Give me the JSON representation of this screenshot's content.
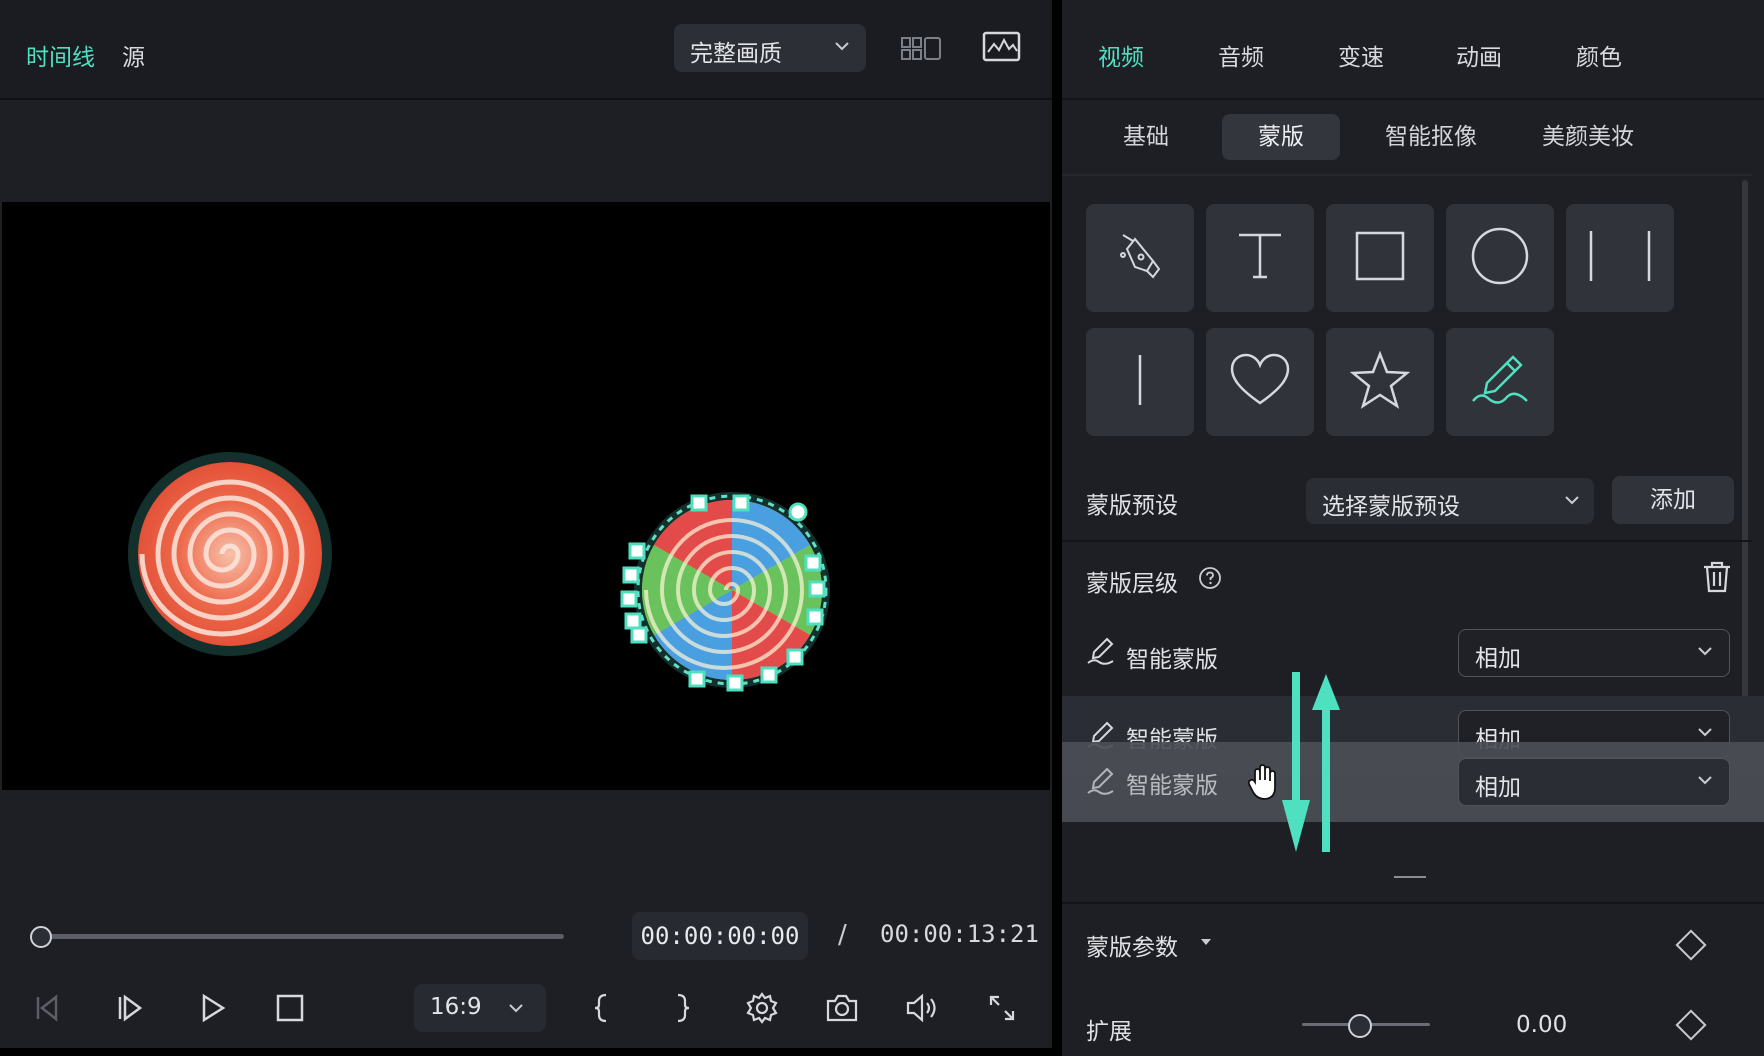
{
  "colors": {
    "accent": "#4fe0c0",
    "panel": "#1d1f24",
    "control": "#30333a"
  },
  "player": {
    "tabs": [
      {
        "label": "时间线",
        "active": true
      },
      {
        "label": "源",
        "active": false
      }
    ],
    "quality": "完整画质",
    "icons": {
      "grid": "grid-view-icon",
      "scope": "waveform-scope-icon"
    },
    "timecode_current": "00:00:00:00",
    "timecode_separator": "/",
    "timecode_total": "00:00:13:21",
    "progress": 0,
    "aspect_ratio": "16:9",
    "controls": [
      "prev-frame-icon",
      "step-forward-icon",
      "play-icon",
      "stop-icon",
      "mark-in-icon",
      "mark-out-icon",
      "settings-icon",
      "snapshot-icon",
      "volume-icon",
      "fullscreen-icon"
    ]
  },
  "panel": {
    "main_tabs": [
      {
        "label": "视频",
        "active": true
      },
      {
        "label": "音频"
      },
      {
        "label": "变速"
      },
      {
        "label": "动画"
      },
      {
        "label": "颜色"
      }
    ],
    "sub_tabs": [
      {
        "label": "基础"
      },
      {
        "label": "蒙版",
        "active": true
      },
      {
        "label": "智能抠像"
      },
      {
        "label": "美颜美妆"
      }
    ],
    "mask_shapes": [
      "pen-icon",
      "text-icon",
      "rectangle-icon",
      "circle-icon",
      "mirror-icon",
      "line-icon",
      "heart-icon",
      "star-icon",
      "smart-brush-icon"
    ],
    "preset": {
      "label": "蒙版预设",
      "select": "选择蒙版预设",
      "add": "添加"
    },
    "layers": {
      "label": "蒙版层级",
      "items": [
        {
          "name": "智能蒙版",
          "mode": "相加"
        },
        {
          "name": "智能蒙版",
          "mode": "相加"
        },
        {
          "name": "智能蒙版",
          "mode": "相加"
        }
      ]
    },
    "params": {
      "label": "蒙版参数",
      "expand_label": "扩展",
      "expand_value": "0.00",
      "expand_fraction": 0.45
    }
  }
}
